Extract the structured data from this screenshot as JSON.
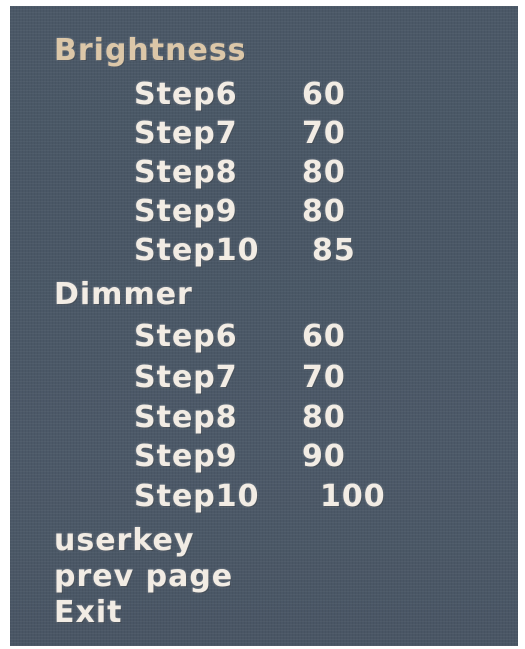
{
  "menu": {
    "brightness": {
      "label": "Brightness",
      "steps": [
        {
          "label": "Step6",
          "value": "60"
        },
        {
          "label": "Step7",
          "value": "70"
        },
        {
          "label": "Step8",
          "value": "80"
        },
        {
          "label": "Step9",
          "value": "80"
        },
        {
          "label": "Step10",
          "value": "85"
        }
      ]
    },
    "dimmer": {
      "label": "Dimmer",
      "steps": [
        {
          "label": "Step6",
          "value": "60"
        },
        {
          "label": "Step7",
          "value": "70"
        },
        {
          "label": "Step8",
          "value": "80"
        },
        {
          "label": "Step9",
          "value": "90"
        },
        {
          "label": "Step10",
          "value": "100"
        }
      ]
    },
    "userkey": "userkey",
    "prev_page": "prev page",
    "exit": "Exit"
  },
  "colors": {
    "background": "#4b5867",
    "text": "#f2ece4",
    "selected": "#dcc7a8"
  }
}
